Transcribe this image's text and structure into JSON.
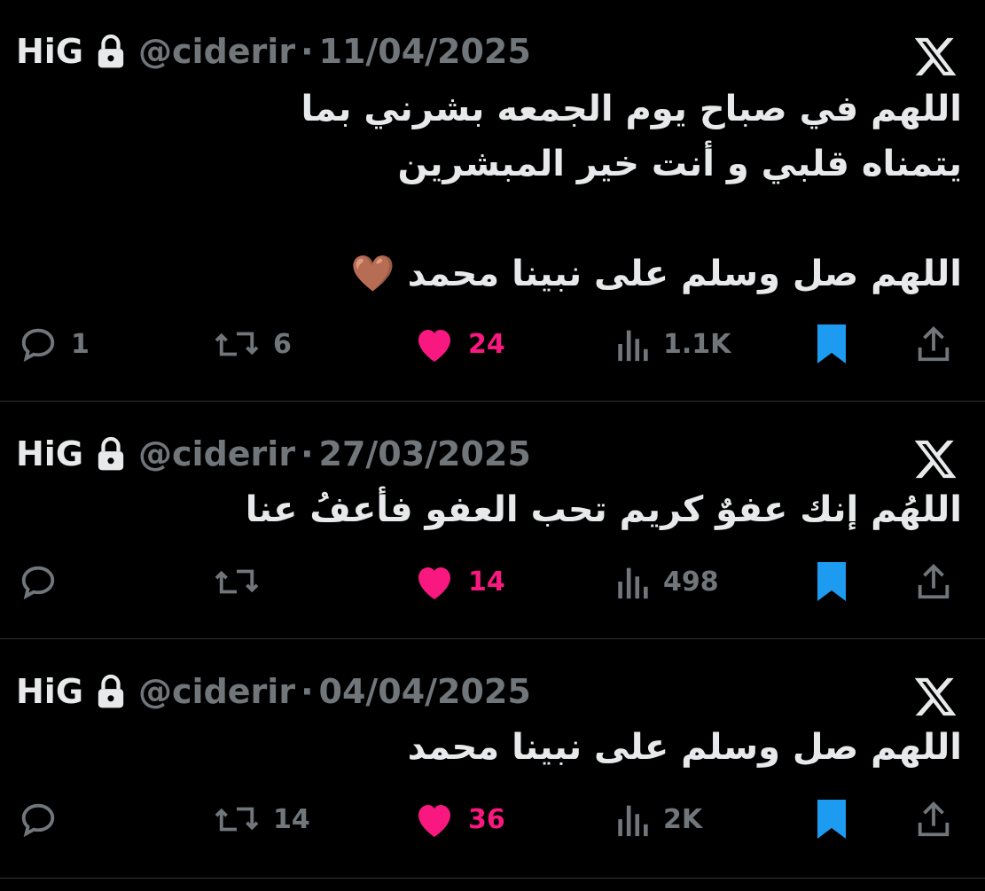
{
  "tweets": [
    {
      "name": "HiG",
      "handle": "@ciderir",
      "separator": "·",
      "date": "11/04/2025",
      "text": "اللهم في صباح  يوم الجمعه بشرني بما\nيتمناه قلبي و أنت خير المبشرين\n\nاللهم صل وسلم على نبينا محمد 🤎",
      "replies": "1",
      "reposts": "6",
      "likes": "24",
      "views": "1.1K"
    },
    {
      "name": "HiG",
      "handle": "@ciderir",
      "separator": "·",
      "date": "27/03/2025",
      "text": "اللهُم إنك عفوٌ كريم تحب العفو فأعفُ عنا",
      "replies": "",
      "reposts": "",
      "likes": "14",
      "views": "498"
    },
    {
      "name": "HiG",
      "handle": "@ciderir",
      "separator": "·",
      "date": "04/04/2025",
      "text": "اللهم صل وسلم على نبينا محمد",
      "replies": "",
      "reposts": "14",
      "likes": "36",
      "views": "2K"
    }
  ],
  "icons": {
    "lock": "lock-icon",
    "x_logo": "x-logo-icon",
    "reply": "reply-icon",
    "repost": "repost-icon",
    "like": "heart-icon",
    "views": "views-icon",
    "bookmark": "bookmark-icon",
    "share": "share-icon"
  },
  "colors": {
    "background": "#000000",
    "text": "#e7e9ea",
    "muted": "#71767b",
    "like": "#f91880",
    "bookmark": "#1d9bf0",
    "divider": "#2f3336"
  }
}
